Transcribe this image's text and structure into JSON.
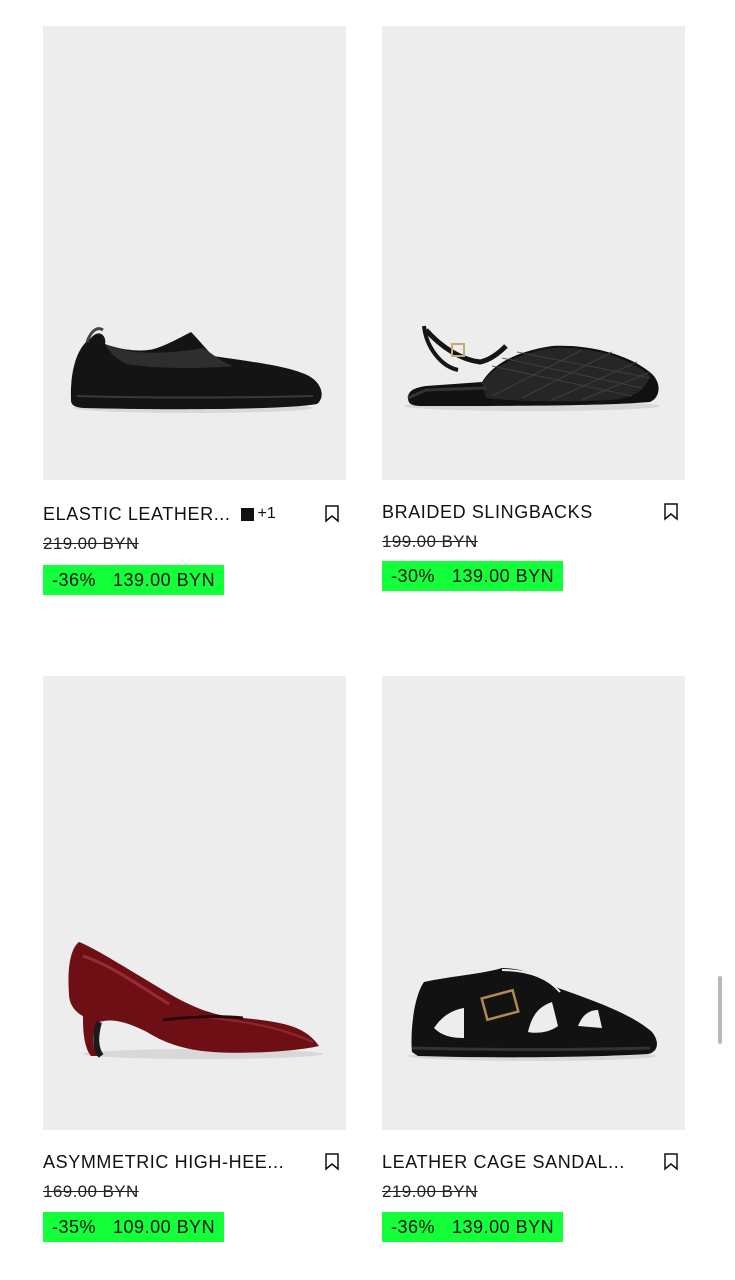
{
  "products": [
    {
      "name": "ELASTIC LEATHER...",
      "image": "black-leather-mary-jane-flat",
      "swatch": "■",
      "extra_colors": "+1",
      "old_price": "219.00 BYN",
      "discount": "-36%",
      "price": "139.00 BYN"
    },
    {
      "name": "BRAIDED SLINGBACKS",
      "image": "black-braided-slingback-flat",
      "old_price": "199.00 BYN",
      "discount": "-30%",
      "price": "139.00 BYN"
    },
    {
      "name": "ASYMMETRIC HIGH-HEE...",
      "image": "burgundy-patent-kitten-heel-pump",
      "old_price": "169.00 BYN",
      "discount": "-35%",
      "price": "109.00 BYN"
    },
    {
      "name": "LEATHER CAGE SANDAL...",
      "image": "black-leather-cage-sandal",
      "old_price": "219.00 BYN",
      "discount": "-36%",
      "price": "139.00 BYN"
    }
  ],
  "colors": {
    "sale_highlight": "#12ff3a",
    "photo_background": "#ededed",
    "text": "#111111"
  },
  "icons": {
    "bookmark": "bookmark-outline-icon"
  }
}
